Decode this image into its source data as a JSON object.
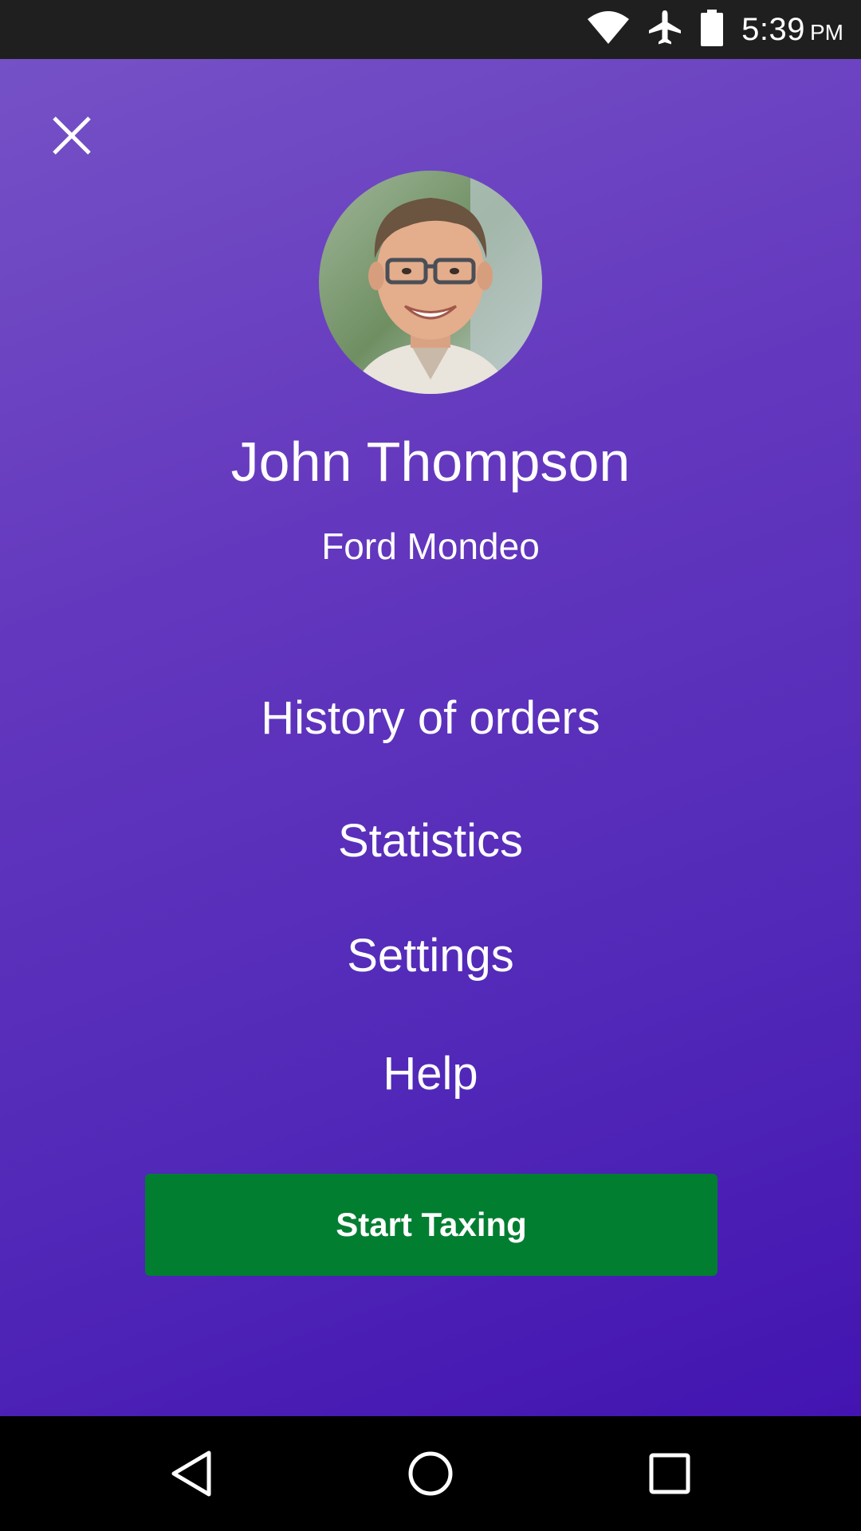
{
  "status_bar": {
    "time": "5:39",
    "ampm": "PM",
    "icons": [
      "wifi-icon",
      "airplane-mode-icon",
      "battery-icon"
    ]
  },
  "drawer": {
    "close_icon": "close-icon",
    "profile": {
      "name": "John Thompson",
      "car": "Ford Mondeo"
    },
    "menu": [
      {
        "label": "History of orders"
      },
      {
        "label": "Statistics"
      },
      {
        "label": "Settings"
      },
      {
        "label": "Help"
      }
    ],
    "primary_button": {
      "label": "Start Taxing",
      "color": "#027e31"
    },
    "background_colors": [
      "#7551c6",
      "#4314b1"
    ]
  },
  "nav_bar": {
    "icons": [
      "back-icon",
      "home-icon",
      "recents-icon"
    ]
  }
}
